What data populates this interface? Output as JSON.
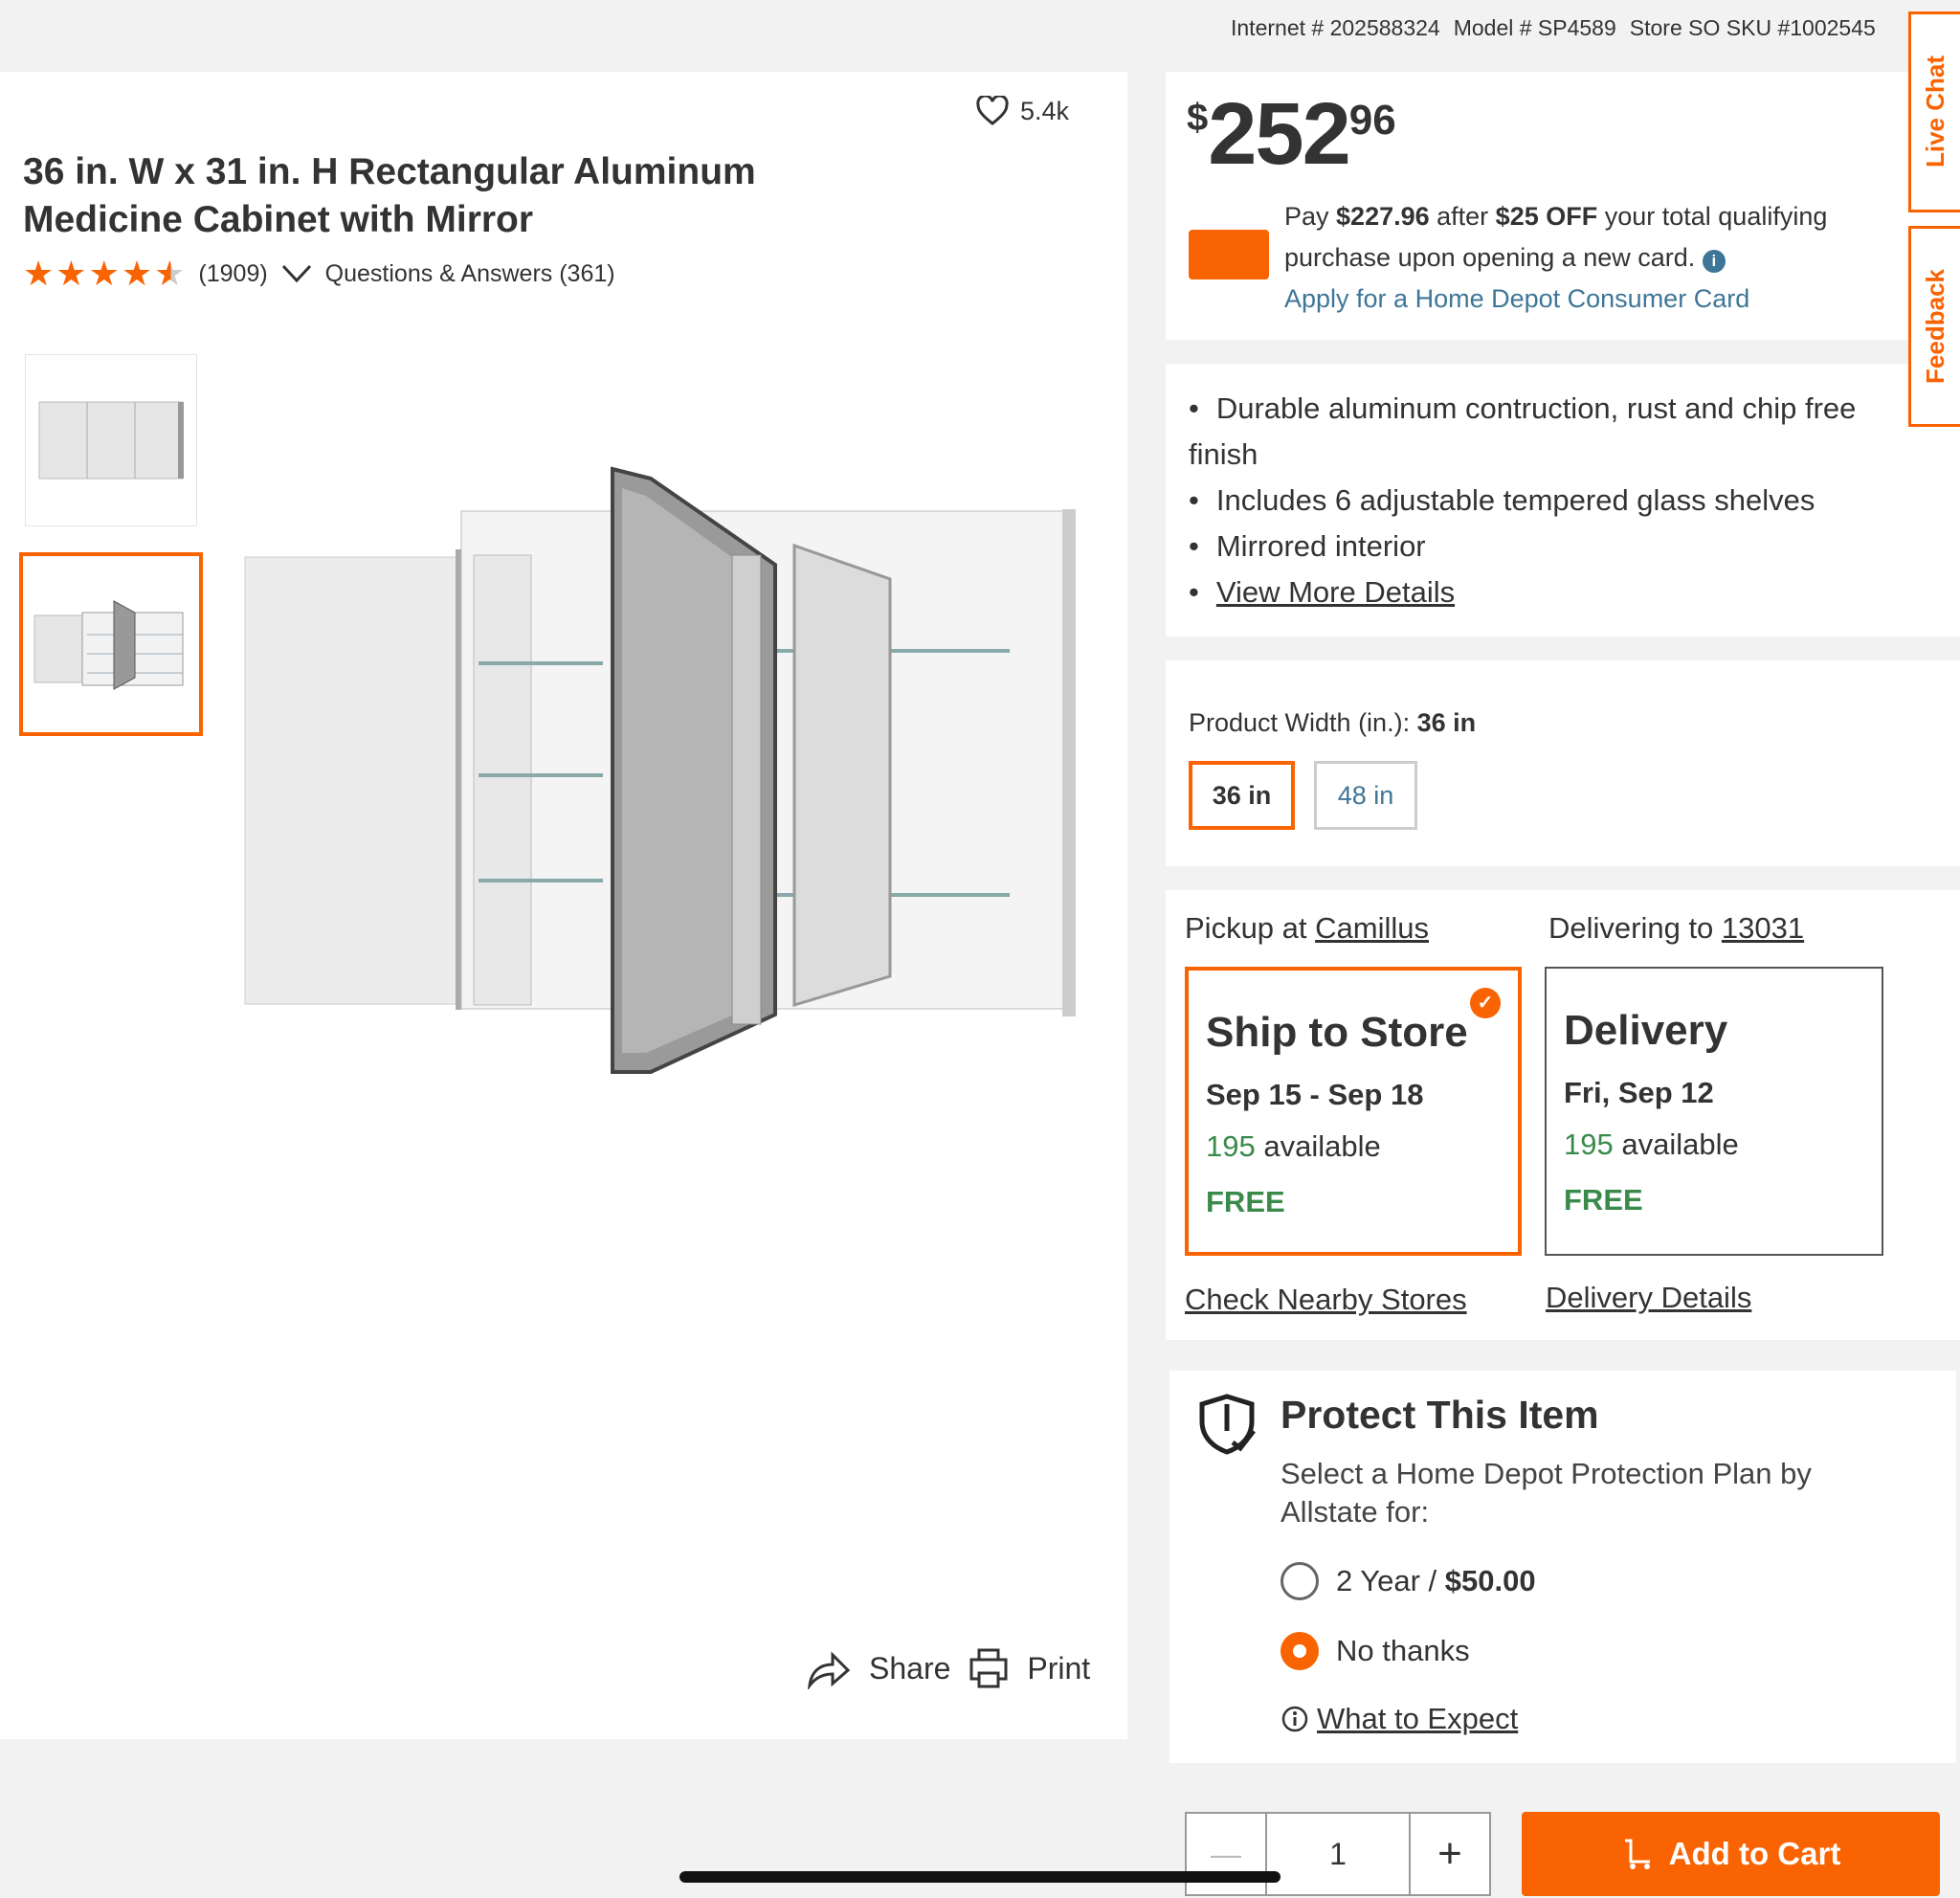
{
  "header": {
    "internet": "Internet # 202588324",
    "model": "Model # SP4589",
    "sku": "Store SO SKU #1002545"
  },
  "product": {
    "favorites": "5.4k",
    "title": "36 in. W x 31 in. H Rectangular Aluminum Medicine Cabinet with Mirror",
    "rating_value": 4.5,
    "review_count": "(1909)",
    "qa_label": "Questions & Answers (361)"
  },
  "actions": {
    "share": "Share",
    "print": "Print"
  },
  "price": {
    "currency": "$",
    "dollars": "252",
    "cents": "96"
  },
  "promo": {
    "text_pre": "Pay ",
    "amount": "$227.96",
    "text_mid": " after ",
    "discount": "$25 OFF",
    "text_post": " your total qualifying purchase upon opening a new card.",
    "link": "Apply for a Home Depot Consumer Card"
  },
  "bullets": [
    "Durable aluminum contruction, rust and chip free finish",
    "Includes 6 adjustable tempered glass shelves",
    "Mirrored interior"
  ],
  "view_more": "View More Details",
  "width": {
    "label": "Product Width (in.): ",
    "value": "36 in",
    "options": [
      "36 in",
      "48 in"
    ]
  },
  "fulfillment": {
    "pickup_label": "Pickup at ",
    "pickup_store": "Camillus",
    "delivery_label": "Delivering to ",
    "delivery_zip": "13031",
    "ship": {
      "title": "Ship to Store",
      "date": "Sep 15 - Sep 18",
      "count": "195",
      "avail": " available",
      "price": "FREE"
    },
    "delivery": {
      "title": "Delivery",
      "date": "Fri, Sep 12",
      "count": "195",
      "avail": " available",
      "price": "FREE"
    },
    "check_nearby": "Check Nearby Stores",
    "delivery_details": "Delivery Details"
  },
  "protect": {
    "title": "Protect This Item",
    "subtitle": "Select a Home Depot Protection Plan by Allstate for:",
    "option1_pre": "2 Year / ",
    "option1_price": "$50.00",
    "option2": "No thanks",
    "what_to_expect": "What to Expect"
  },
  "cart": {
    "quantity": "1",
    "minus": "—",
    "plus": "+",
    "add_label": "Add to Cart"
  },
  "side_tabs": {
    "live_chat": "Live Chat",
    "feedback": "Feedback"
  },
  "colors": {
    "accent": "#f96302",
    "link": "#3e7697",
    "green": "#3a8a4b"
  }
}
